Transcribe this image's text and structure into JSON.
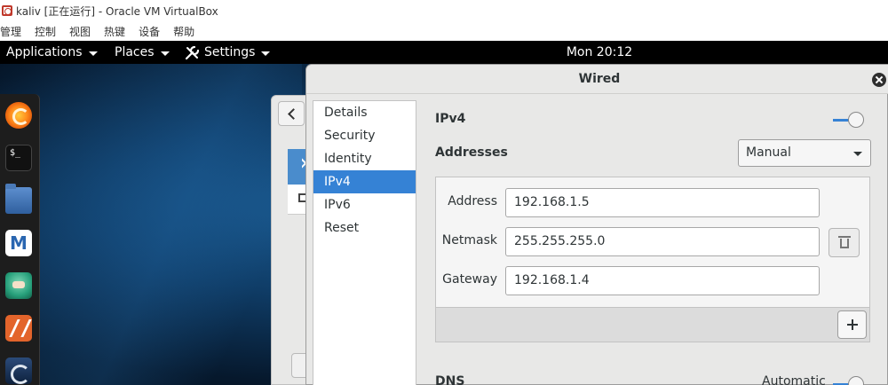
{
  "host": {
    "title": "kaliv [正在运行] - Oracle VM VirtualBox",
    "menu": [
      "管理",
      "控制",
      "视图",
      "热键",
      "设备",
      "帮助"
    ]
  },
  "topbar": {
    "applications": "Applications",
    "places": "Places",
    "settings": "Settings",
    "clock": "Mon 20:12"
  },
  "dock": {
    "items": [
      "firefox-icon",
      "terminal-icon",
      "files-icon",
      "metasploit-icon",
      "anime-app-icon",
      "burpsuite-icon",
      "last-app-icon"
    ]
  },
  "dialog": {
    "title": "Wired",
    "sidebar": [
      "Details",
      "Security",
      "Identity",
      "IPv4",
      "IPv6",
      "Reset"
    ],
    "active_tab": "IPv4",
    "section_title": "IPv4",
    "ipv4_enabled": true,
    "addresses_label": "Addresses",
    "method": "Manual",
    "fields": {
      "address_label": "Address",
      "address_value": "192.168.1.5",
      "netmask_label": "Netmask",
      "netmask_value": "255.255.255.0",
      "gateway_label": "Gateway",
      "gateway_value": "192.168.1.4"
    },
    "dns_label": "DNS",
    "dns_mode": "Automatic"
  },
  "colors": {
    "accent": "#3582d5",
    "topbar": "#000000",
    "dialog_bg": "#e8e8e7"
  }
}
